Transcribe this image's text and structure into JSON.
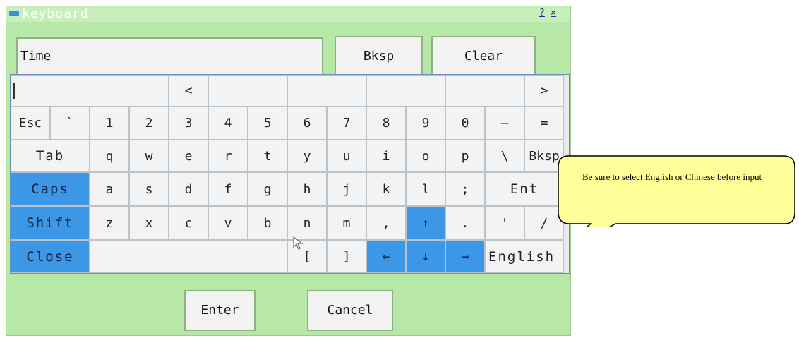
{
  "window": {
    "title": "keyboard",
    "help_label": "?",
    "close_label": "×"
  },
  "input": {
    "value": "Time"
  },
  "top_buttons": {
    "bksp": "Bksp",
    "clear": "Clear"
  },
  "candidates": {
    "prev": "<",
    "next": ">"
  },
  "rows": [
    [
      "Esc",
      "`",
      "1",
      "2",
      "3",
      "4",
      "5",
      "6",
      "7",
      "8",
      "9",
      "0",
      "—",
      "="
    ],
    [
      "Tab",
      "q",
      "w",
      "e",
      "r",
      "t",
      "y",
      "u",
      "i",
      "o",
      "p",
      "\\",
      "Bksp"
    ],
    [
      "Caps",
      "a",
      "s",
      "d",
      "f",
      "g",
      "h",
      "j",
      "k",
      "l",
      ";",
      "Ent"
    ],
    [
      "Shift",
      "z",
      "x",
      "c",
      "v",
      "b",
      "n",
      "m",
      ",",
      "↑",
      ".",
      "'",
      "/"
    ],
    [
      "Close",
      "",
      "[",
      "]",
      "←",
      "↓",
      "→",
      "English"
    ]
  ],
  "bottom_buttons": {
    "enter": "Enter",
    "cancel": "Cancel"
  },
  "callout": {
    "text": "Be sure to select English or Chinese before input"
  },
  "colors": {
    "window_bg": "#b8e8a8",
    "accent_key": "#3c97e6",
    "callout_bg": "#ffff99"
  }
}
